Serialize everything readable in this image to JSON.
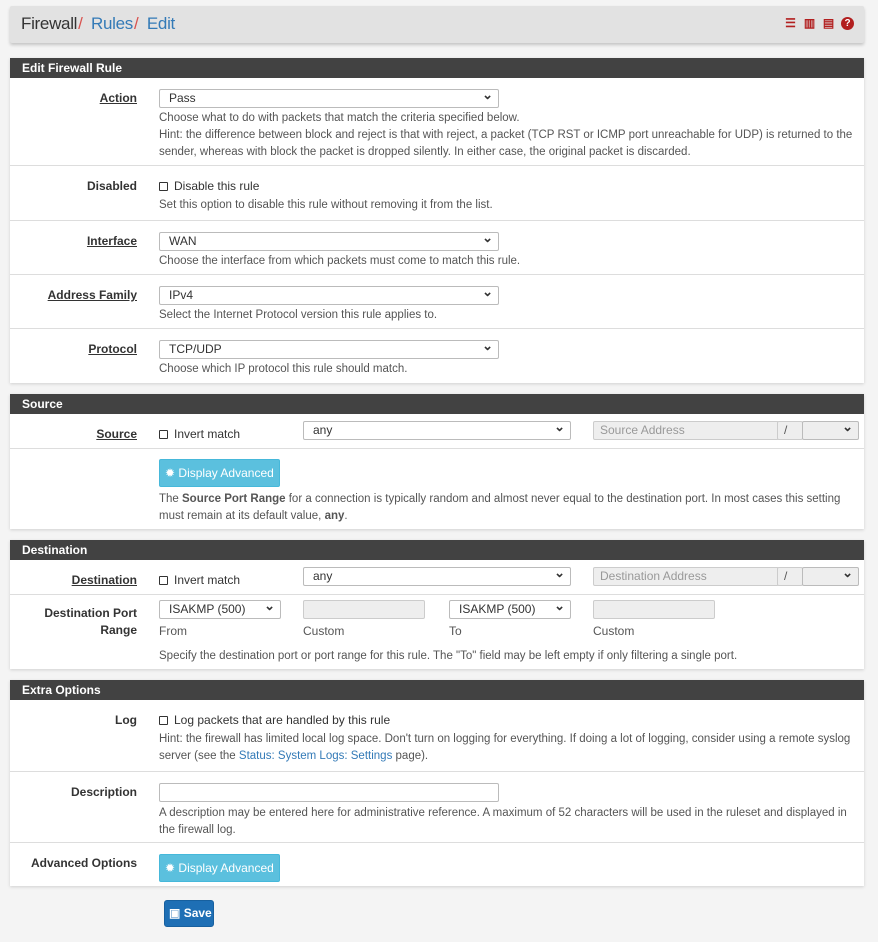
{
  "breadcrumb": {
    "root": "Firewall",
    "rules": "Rules",
    "edit": "Edit",
    "sep": "/"
  },
  "header_icons": [
    "sliders-icon",
    "bar-chart-icon",
    "list-icon",
    "help-icon"
  ],
  "edit_rule": {
    "title": "Edit Firewall Rule",
    "action": {
      "label": "Action",
      "value": "Pass",
      "help1": "Choose what to do with packets that match the criteria specified below.",
      "help2": "Hint: the difference between block and reject is that with reject, a packet (TCP RST or ICMP port unreachable for UDP) is returned to the sender, whereas with block the packet is dropped silently. In either case, the original packet is discarded."
    },
    "disabled": {
      "label": "Disabled",
      "checkbox": "Disable this rule",
      "help": "Set this option to disable this rule without removing it from the list."
    },
    "interface": {
      "label": "Interface",
      "value": "WAN",
      "help": "Choose the interface from which packets must come to match this rule."
    },
    "address_family": {
      "label": "Address Family",
      "value": "IPv4",
      "help": "Select the Internet Protocol version this rule applies to."
    },
    "protocol": {
      "label": "Protocol",
      "value": "TCP/UDP",
      "help": "Choose which IP protocol this rule should match."
    }
  },
  "source": {
    "title": "Source",
    "label": "Source",
    "invert": "Invert match",
    "value": "any",
    "address_placeholder": "Source Address",
    "slash": "/",
    "advanced_button": "Display Advanced",
    "help_pre": "The ",
    "help_bold": "Source Port Range",
    "help_mid": " for a connection is typically random and almost never equal to the destination port. In most cases this setting must remain at its default value, ",
    "help_bold2": "any",
    "help_end": "."
  },
  "destination": {
    "title": "Destination",
    "label": "Destination",
    "invert": "Invert match",
    "value": "any",
    "address_placeholder": "Destination Address",
    "slash": "/",
    "port_range": {
      "label": "Destination Port Range",
      "from_value": "ISAKMP (500)",
      "from": "From",
      "custom": "Custom",
      "to_value": "ISAKMP (500)",
      "to": "To",
      "custom2": "Custom",
      "help": "Specify the destination port or port range for this rule. The \"To\" field may be left empty if only filtering a single port."
    }
  },
  "extra": {
    "title": "Extra Options",
    "log": {
      "label": "Log",
      "checkbox": "Log packets that are handled by this rule",
      "help_pre": "Hint: the firewall has limited local log space. Don't turn on logging for everything. If doing a lot of logging, consider using a remote syslog server (see the ",
      "link": "Status: System Logs: Settings",
      "help_end": " page)."
    },
    "description": {
      "label": "Description",
      "value": "",
      "help": "A description may be entered here for administrative reference. A maximum of 52 characters will be used in the ruleset and displayed in the firewall log."
    },
    "advanced": {
      "label": "Advanced Options",
      "button": "Display Advanced"
    }
  },
  "save_label": "Save"
}
